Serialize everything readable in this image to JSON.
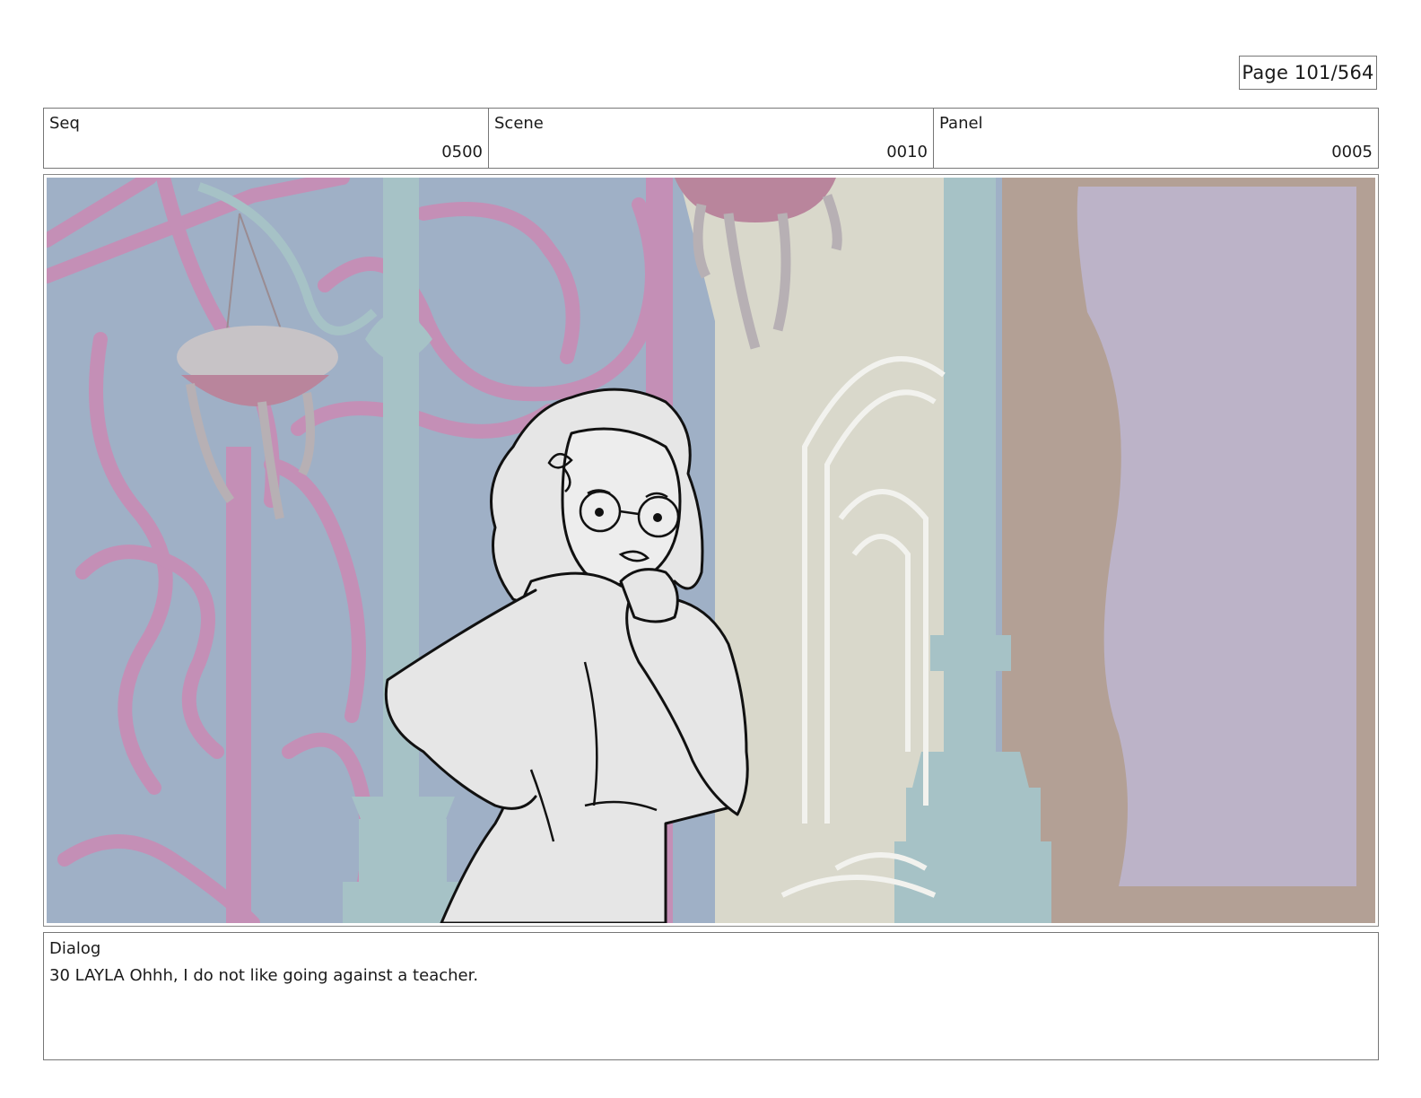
{
  "page": {
    "label": "Page 101/564"
  },
  "header": {
    "seq": {
      "label": "Seq",
      "value": "0500"
    },
    "scene": {
      "label": "Scene",
      "value": "0010"
    },
    "panel": {
      "label": "Panel",
      "value": "0005"
    }
  },
  "dialog": {
    "label": "Dialog",
    "text": "30 LAYLA Ohhh, I do not like going against a teacher."
  },
  "colors": {
    "sky": "#9fb0c6",
    "ironwork_pink": "#c48fb6",
    "pillar_teal": "#a6c2c6",
    "wall_cream": "#d9d8cb",
    "brown_frame": "#b3a095",
    "window_lilac": "#bcb3c8",
    "sketch_fill": "#e6e6e6",
    "sketch_line": "#111111"
  }
}
